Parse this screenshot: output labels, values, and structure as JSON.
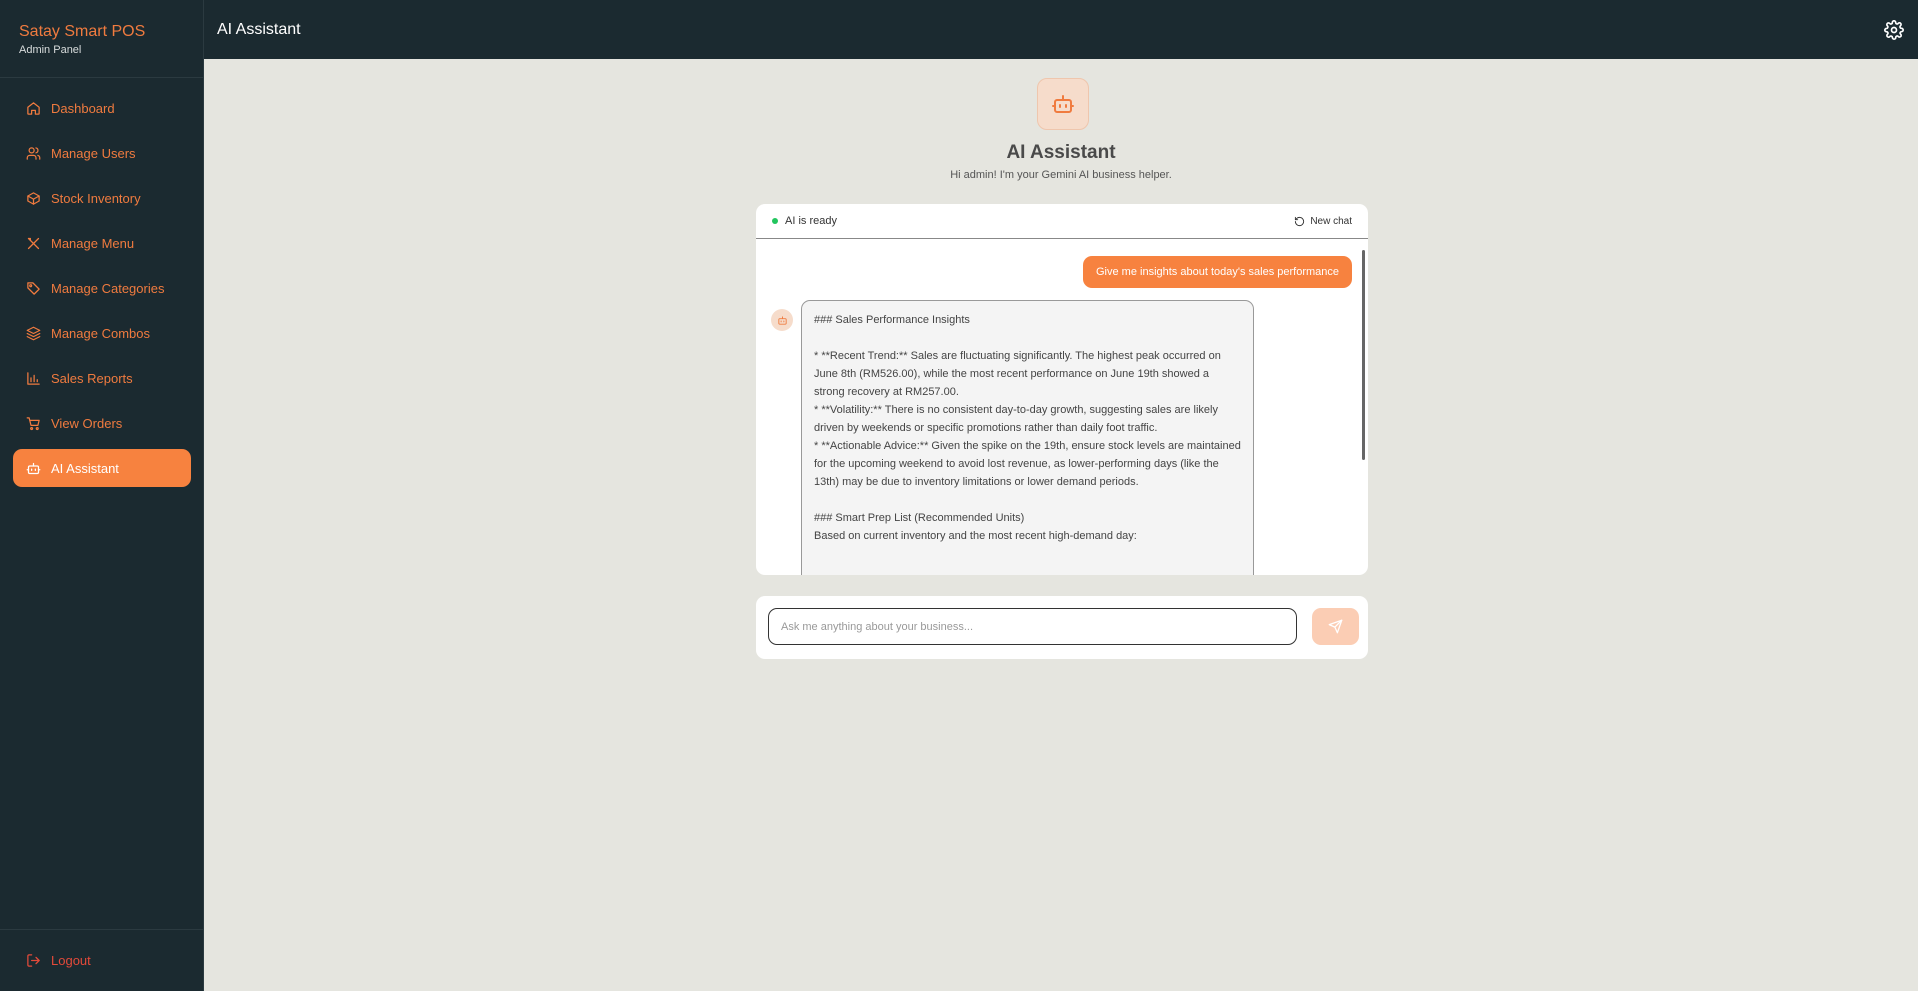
{
  "brand": {
    "title": "Satay Smart POS",
    "subtitle": "Admin Panel"
  },
  "sidebar": {
    "items": [
      {
        "label": "Dashboard",
        "icon": "home-icon"
      },
      {
        "label": "Manage Users",
        "icon": "users-icon"
      },
      {
        "label": "Stock Inventory",
        "icon": "box-icon"
      },
      {
        "label": "Manage Menu",
        "icon": "utensils-icon"
      },
      {
        "label": "Manage Categories",
        "icon": "tags-icon"
      },
      {
        "label": "Manage Combos",
        "icon": "layers-icon"
      },
      {
        "label": "Sales Reports",
        "icon": "bar-chart-icon"
      },
      {
        "label": "View Orders",
        "icon": "cart-icon"
      },
      {
        "label": "AI Assistant",
        "icon": "bot-icon",
        "active": true
      }
    ],
    "logout": "Logout"
  },
  "header": {
    "title": "AI Assistant",
    "settings_icon": "gear-icon"
  },
  "hero": {
    "title": "AI Assistant",
    "subtitle": "Hi admin! I'm your Gemini AI business helper."
  },
  "chat": {
    "status": "AI is ready",
    "new_chat": "New chat",
    "user_message": "Give me insights about today's sales performance",
    "bot_lines": [
      "### Sales Performance Insights",
      "",
      "* **Recent Trend:** Sales are fluctuating significantly. The highest peak occurred on June 8th (RM526.00), while the most recent performance on June 19th showed a strong recovery at RM257.00.",
      "* **Volatility:** There is no consistent day-to-day growth, suggesting sales are likely driven by weekends or specific promotions rather than daily foot traffic.",
      "* **Actionable Advice:** Given the spike on the 19th, ensure stock levels are maintained for the upcoming weekend to avoid lost revenue, as lower-performing days (like the 13th) may be due to inventory limitations or lower demand periods.",
      "",
      "### Smart Prep List (Recommended Units)",
      "Based on current inventory and the most recent high-demand day:"
    ]
  },
  "input": {
    "placeholder": "Ask me anything about your business...",
    "value": ""
  },
  "colors": {
    "accent": "#f7823f",
    "sidebar_bg": "#1b2a30",
    "logout": "#e34a3a",
    "status": "#22c55e"
  }
}
